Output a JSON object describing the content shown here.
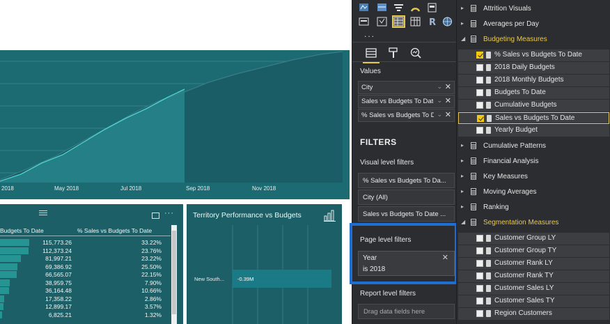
{
  "colors": {
    "canvas_bg": "#ffffff",
    "visual_bg": "#1d5f67",
    "pane_bg": "#2c2d30",
    "accent_yellow": "#e8c84a",
    "highlight_border": "#1e6fd1",
    "data_bar": "#2aa6a2"
  },
  "line_chart": {
    "x_ticks": [
      "2018",
      "May 2018",
      "Jul 2018",
      "Sep 2018",
      "Nov 2018"
    ]
  },
  "table_visual": {
    "col_headers": [
      "Budgets To Date",
      "% Sales vs Budgets To Date"
    ],
    "more_icon": "more-options-icon",
    "focus_icon": "focus-mode-icon",
    "rows": [
      {
        "budget": "115,773.26",
        "pct": "33.22%",
        "fill": 1.0
      },
      {
        "budget": "112,373.24",
        "pct": "23.76%",
        "fill": 0.97
      },
      {
        "budget": "81,997.21",
        "pct": "23.22%",
        "fill": 0.71
      },
      {
        "budget": "69,386.92",
        "pct": "25.50%",
        "fill": 0.6
      },
      {
        "budget": "66,565.07",
        "pct": "22.15%",
        "fill": 0.57
      },
      {
        "budget": "38,959.75",
        "pct": "7.90%",
        "fill": 0.34
      },
      {
        "budget": "36,164.48",
        "pct": "10.66%",
        "fill": 0.31
      },
      {
        "budget": "17,358.22",
        "pct": "2.86%",
        "fill": 0.15
      },
      {
        "budget": "12,899.17",
        "pct": "3.57%",
        "fill": 0.11
      },
      {
        "budget": "6,825.21",
        "pct": "1.32%",
        "fill": 0.06
      }
    ]
  },
  "bar_visual": {
    "title": "Territory Performance vs Budgets",
    "category": "New South...",
    "value_label": "-0.39M"
  },
  "viz_pane": {
    "more_label": "...",
    "values_label": "Values",
    "value_fields": [
      "City",
      "Sales vs Budgets To Date",
      "% Sales vs Budgets To D"
    ],
    "filters_title": "FILTERS",
    "visual_level_label": "Visual level filters",
    "visual_filters": [
      "% Sales vs Budgets To Da...",
      "City (All)",
      "Sales vs Budgets To Date ..."
    ],
    "page_level_label": "Page level filters",
    "page_filter": {
      "field": "Year",
      "condition": "is 2018"
    },
    "report_level_label": "Report level filters",
    "drop_placeholder": "Drag data fields here"
  },
  "fields_pane": {
    "tables_top": [
      "Attrition Visuals",
      "Averages per Day"
    ],
    "expanded_table": "Budgeting Measures",
    "measures": [
      {
        "label": "% Sales vs Budgets To Date",
        "checked": true
      },
      {
        "label": "2018 Daily Budgets",
        "checked": false
      },
      {
        "label": "2018 Monthly Budgets",
        "checked": false
      },
      {
        "label": "Budgets To Date",
        "checked": false
      },
      {
        "label": "Cumulative Budgets",
        "checked": false
      },
      {
        "label": "Sales vs Budgets To Date",
        "checked": true
      },
      {
        "label": "Yearly Budget",
        "checked": false
      }
    ],
    "tables_mid": [
      "Cumulative Patterns",
      "Financial Analysis",
      "Key Measures",
      "Moving Averages",
      "Ranking"
    ],
    "expanded_table_2": "Segmentation Measures",
    "measures_2": [
      "Customer Group LY",
      "Customer Group TY",
      "Customer Rank LY",
      "Customer Rank TY",
      "Customer Sales LY",
      "Customer Sales TY",
      "Region Customers"
    ]
  }
}
